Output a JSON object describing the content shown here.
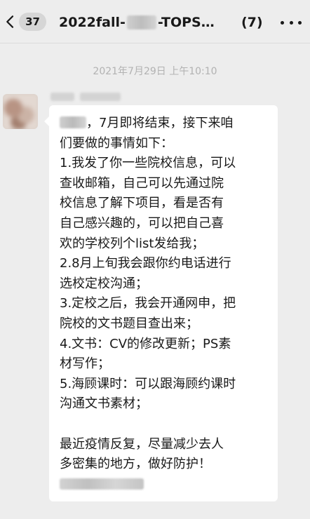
{
  "header": {
    "back_badge": "37",
    "title_prefix": "2022fall-",
    "title_suffix": "-TOPS…",
    "member_count": "(7)"
  },
  "chat": {
    "timestamp": "2021年7月29日 上午10:10",
    "message": {
      "lines": [
        "，7月即将结束，接下来咱",
        "们要做的事情如下：",
        "1.我发了你一些院校信息，可以",
        "查收邮箱，自己可以先通过院",
        "校信息了解下项目，看是否有",
        "自己感兴趣的，可以把自己喜",
        "欢的学校列个list发给我；",
        "2.8月上旬我会跟你约电话进行",
        "选校定校沟通；",
        "3.定校之后，我会开通网申，把",
        "院校的文书题目查出来；",
        "4.文书：CV的修改更新；PS素",
        "材写作；",
        "5.海顾课时：可以跟海顾约课时",
        "沟通文书素材；",
        "",
        "最近疫情反复，尽量减少去人",
        "多密集的地方，做好防护！"
      ]
    }
  },
  "icons": {
    "back": "chevron-left-icon",
    "more": "more-dots-icon"
  },
  "colors": {
    "background": "#ededed",
    "bubble": "#ffffff",
    "timestamp": "#b2b2b2"
  }
}
